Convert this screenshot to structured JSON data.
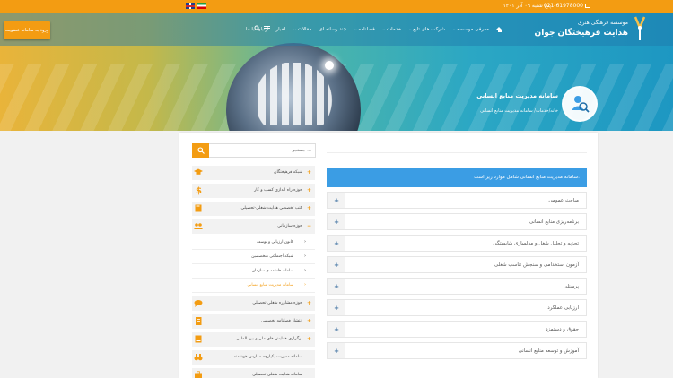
{
  "topbar": {
    "date": "پنج شنبه ۰۹ آذر ۱۴۰۱",
    "phone": "021-61978000"
  },
  "logo": {
    "line1": "موسسه فرهنگی هنری",
    "line2": "هدایت فرهیختگان جوان"
  },
  "nav": {
    "items": [
      {
        "label": "معرفی موسسه",
        "has_dropdown": true
      },
      {
        "label": "شرکت های تابع",
        "has_dropdown": true
      },
      {
        "label": "خدمات",
        "has_dropdown": true
      },
      {
        "label": "فصلنامه",
        "has_dropdown": true
      },
      {
        "label": "چند رسانه ای",
        "has_dropdown": false
      },
      {
        "label": "مقالات",
        "has_dropdown": true
      },
      {
        "label": "اخبار",
        "has_dropdown": false
      },
      {
        "label": "ارتباط با ما",
        "has_dropdown": false
      }
    ],
    "register_label": "ورود به سامانه عضویت"
  },
  "hero": {
    "title": "سامانه مدیریت منابع انسانی",
    "breadcrumb": "خانه/خدمات/ سامانه مدیریت منابع انسانی"
  },
  "search": {
    "placeholder": "جستجو ..."
  },
  "sidebar": {
    "items": [
      {
        "label": "شبکه فرهیختگان",
        "icon": "graduation-cap-icon"
      },
      {
        "label": "حوزه راه اندازی کسب و کار",
        "icon": "dollar-icon"
      },
      {
        "label": "کتب تخصصی هدایت شغلی-تحصیلی",
        "icon": "book-icon"
      },
      {
        "label": "حوزه سازمانی",
        "icon": "users-icon",
        "expanded": true
      }
    ],
    "subitems": [
      {
        "label": "کانون ارزیابی و توسعه"
      },
      {
        "label": "شبکه اجتماعی متخصصین"
      },
      {
        "label": "سامانه هاشمه ی سازمان"
      },
      {
        "label": "سامانه مدیریت منابع انسانی",
        "active": true
      }
    ],
    "items_after": [
      {
        "label": "حوزه مشاوره شغلی-تحصیلی",
        "icon": "chat-icon"
      },
      {
        "label": "انتشار فصلنامه تخصصی",
        "icon": "notebook-icon"
      },
      {
        "label": "برگزاری همایش های ملی و بین المللی",
        "icon": "book-icon"
      },
      {
        "label": "سامانه مدیریت یکپارچه مدارس هوشمند",
        "icon": "binoculars-icon"
      },
      {
        "label": "سامانه هدایت شغلی-تحصیلی",
        "icon": "briefcase-icon"
      }
    ]
  },
  "main": {
    "header": "سامانه مدیریت منابع انسانی شامل موارد زیر است:",
    "accordion": [
      "مباحث عمومی",
      "برنامه‌ریزی منابع انسانی",
      "تجزیه و تحلیل شغل و مدلسازی شایستگی",
      "آزمون استخدامی و سنجش تناسب شغلی",
      "پرسنلی",
      "ارزیابی عملکرد",
      "حقوق و دستمزد",
      "آموزش و توسعه منابع انسانی"
    ]
  },
  "colors": {
    "accent": "#f39c12",
    "primary": "#3b9de4"
  }
}
